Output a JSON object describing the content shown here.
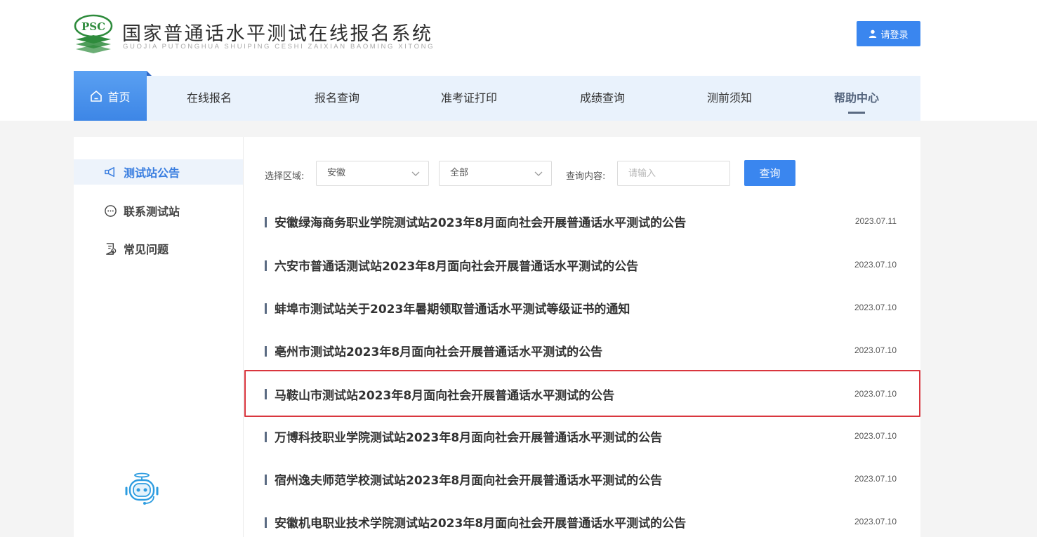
{
  "header": {
    "logo_text": "PSC",
    "title": "国家普通话水平测试在线报名系统",
    "subtitle": "GUOJIA PUTONGHUA SHUIPING CESHI ZAIXIAN BAOMING XITONG",
    "login_label": "请登录"
  },
  "nav": {
    "home_label": "首页",
    "items": [
      {
        "label": "在线报名"
      },
      {
        "label": "报名查询"
      },
      {
        "label": "准考证打印"
      },
      {
        "label": "成绩查询"
      },
      {
        "label": "测前须知"
      },
      {
        "label": "帮助中心"
      }
    ]
  },
  "sidebar": {
    "items": [
      {
        "label": "测试站公告",
        "icon": "megaphone-icon"
      },
      {
        "label": "联系测试站",
        "icon": "chat-icon"
      },
      {
        "label": "常见问题",
        "icon": "faq-document-icon"
      }
    ]
  },
  "filter": {
    "region_label": "选择区域:",
    "region_value": "安徽",
    "type_value": "全部",
    "query_label": "查询内容:",
    "query_placeholder": "请输入",
    "query_value": "",
    "search_button": "查询"
  },
  "notices": [
    {
      "title": "安徽绿海商务职业学院测试站2023年8月面向社会开展普通话水平测试的公告",
      "date": "2023.07.11"
    },
    {
      "title": "六安市普通话测试站2023年8月面向社会开展普通话水平测试的公告",
      "date": "2023.07.10"
    },
    {
      "title": "蚌埠市测试站关于2023年暑期领取普通话水平测试等级证书的通知",
      "date": "2023.07.10"
    },
    {
      "title": "亳州市测试站2023年8月面向社会开展普通话水平测试的公告",
      "date": "2023.07.10"
    },
    {
      "title": "马鞍山市测试站2023年8月面向社会开展普通话水平测试的公告",
      "date": "2023.07.10"
    },
    {
      "title": "万博科技职业学院测试站2023年8月面向社会开展普通话水平测试的公告",
      "date": "2023.07.10"
    },
    {
      "title": "宿州逸夫师范学校测试站2023年8月面向社会开展普通话水平测试的公告",
      "date": "2023.07.10"
    },
    {
      "title": "安徽机电职业技术学院测试站2023年8月面向社会开展普通话水平测试的公告",
      "date": "2023.07.10"
    }
  ],
  "colors": {
    "accent": "#3a86ef",
    "logo_green": "#2e8b3c",
    "nav_bg": "#e9f2fc",
    "highlight_border": "#d9363e"
  }
}
